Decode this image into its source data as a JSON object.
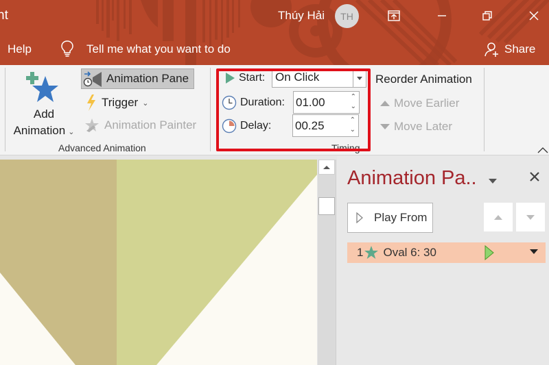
{
  "titlebar": {
    "title_fragment": "nt",
    "user_name": "Thúy Hải",
    "user_initials": "TH",
    "window_buttons": [
      {
        "name": "ribbon-display-options",
        "icon": "ribbon-display-icon"
      },
      {
        "name": "minimize",
        "icon": "minimize-icon"
      },
      {
        "name": "restore",
        "icon": "restore-icon"
      },
      {
        "name": "close",
        "icon": "close-icon"
      }
    ],
    "help_tab": "Help",
    "tell_me_placeholder": "Tell me what you want to do",
    "share_label": "Share"
  },
  "ribbon": {
    "advanced_animation": {
      "add_animation_line1": "Add",
      "add_animation_line2": "Animation",
      "animation_pane": "Animation Pane",
      "trigger": "Trigger",
      "animation_painter": "Animation Painter",
      "group_label": "Advanced Animation"
    },
    "timing": {
      "start_label": "Start:",
      "start_value": "On Click",
      "duration_label": "Duration:",
      "duration_value": "01.00",
      "delay_label": "Delay:",
      "delay_value": "00.25",
      "group_label": "Timing",
      "highlight_color": "#e0101a"
    },
    "reorder": {
      "title": "Reorder Animation",
      "move_earlier": "Move Earlier",
      "move_later": "Move Later"
    }
  },
  "colors": {
    "titlebar_bg": "#b7472a",
    "accent_red": "#a4262c",
    "animation_item_bg": "#f8c8ad",
    "slide_tan": "#c9bb86",
    "slide_green": "#d2d492",
    "slide_cream": "#fcfaf3"
  },
  "animation_pane": {
    "title": "Animation Pa..",
    "play_from_label": "Play From",
    "items": [
      {
        "index": "1",
        "name": "Oval 6: 30",
        "effect_icon": "star-icon"
      }
    ]
  }
}
